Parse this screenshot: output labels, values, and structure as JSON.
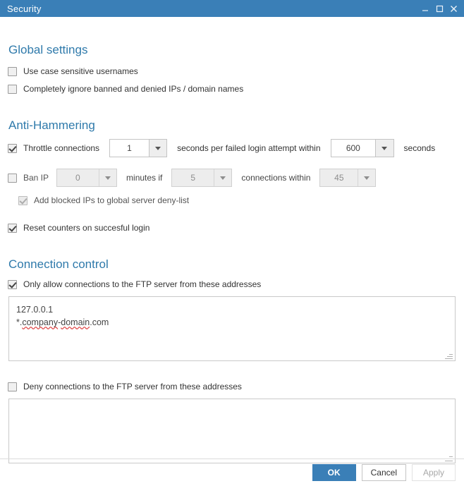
{
  "window": {
    "title": "Security",
    "controls": {
      "minimize": "minimize-icon",
      "maximize": "maximize-icon",
      "close": "close-icon"
    },
    "accent_color": "#3a7fb7",
    "header_color": "#2f7aab"
  },
  "global_settings": {
    "title": "Global settings",
    "options": [
      {
        "label": "Use case sensitive usernames",
        "checked": false,
        "enabled": true
      },
      {
        "label": "Completely ignore banned and denied IPs / domain names",
        "checked": false,
        "enabled": true
      }
    ]
  },
  "anti_hammering": {
    "title": "Anti-Hammering",
    "throttle": {
      "label": "Throttle connections",
      "checked": true,
      "enabled": true,
      "seconds_value": "1",
      "mid_text": "seconds per failed login attempt within",
      "within_value": "600",
      "tail_text": "seconds"
    },
    "ban_ip": {
      "label": "Ban IP",
      "checked": false,
      "enabled": false,
      "minutes_value": "0",
      "text_minutes_if": "minutes if",
      "connections_value": "5",
      "text_connections_within": "connections within",
      "within_value": "45"
    },
    "deny_list": {
      "label": "Add blocked IPs to global server deny-list",
      "checked": true,
      "enabled": false
    },
    "reset_counters": {
      "label": "Reset counters on succesful login",
      "checked": true,
      "enabled": true
    }
  },
  "connection_control": {
    "title": "Connection control",
    "allow": {
      "label": "Only allow connections to the FTP server from these addresses",
      "checked": true,
      "enabled": true,
      "lines": [
        "127.0.0.1",
        "*.company-domain.com"
      ]
    },
    "deny": {
      "label": "Deny connections to the FTP server from these addresses",
      "checked": false,
      "enabled": true,
      "lines": []
    }
  },
  "footer": {
    "ok": "OK",
    "cancel": "Cancel",
    "apply": "Apply"
  }
}
